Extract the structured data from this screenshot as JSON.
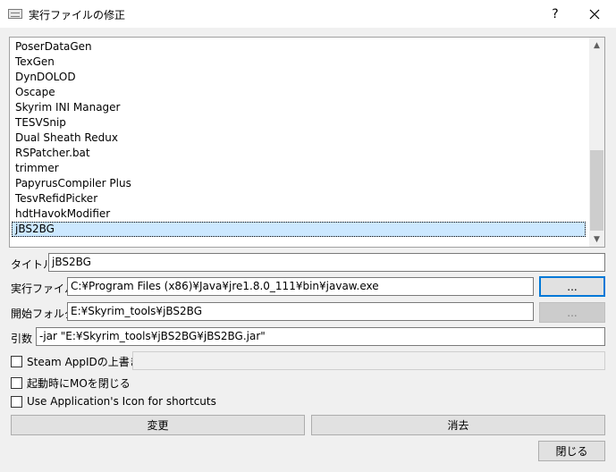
{
  "window": {
    "title": "実行ファイルの修正",
    "help_glyph": "?",
    "close_glyph": "✕"
  },
  "list": {
    "items": [
      "PoserDataGen",
      "TexGen",
      "DynDOLOD",
      "Oscape",
      "Skyrim INI Manager",
      "TESVSnip",
      "Dual Sheath Redux",
      "RSPatcher.bat",
      "trimmer",
      "PapyrusCompiler Plus",
      "TesvRefidPicker",
      "hdtHavokModifier",
      "jBS2BG"
    ],
    "selected_item": "jBS2BG",
    "scroll_up_glyph": "▲",
    "scroll_down_glyph": "▼"
  },
  "form": {
    "title_label": "タイトル",
    "title_value": "jBS2BG",
    "exe_label": "実行ファイル",
    "exe_value": "C:¥Program Files (x86)¥Java¥jre1.8.0_111¥bin¥javaw.exe",
    "exe_browse": "...",
    "start_label": "開始フォルダ",
    "start_value": "E:¥Skyrim_tools¥jBS2BG",
    "start_browse": "...",
    "args_label": "引数",
    "args_value": "-jar \"E:¥Skyrim_tools¥jBS2BG¥jBS2BG.jar\"",
    "steam_label": "Steam AppIDの上書き",
    "steam_value": "",
    "close_mo_label": "起動時にMOを閉じる",
    "app_icon_label": "Use Application's Icon for shortcuts"
  },
  "buttons": {
    "modify": "変更",
    "delete": "消去",
    "close": "閉じる"
  },
  "colors": {
    "selection": "#cce8ff",
    "focus_border": "#0078d7",
    "window_bg": "#f0f0f0"
  }
}
